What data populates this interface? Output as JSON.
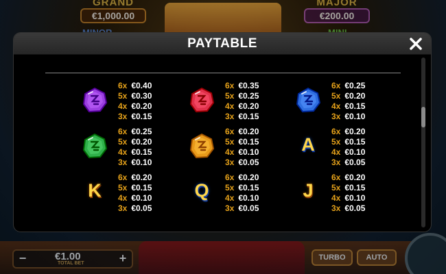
{
  "background": {
    "grand": {
      "label": "GRAND",
      "value": "€1,000.00"
    },
    "major": {
      "label": "MAJOR",
      "value": "€200.00"
    },
    "minor_label": "MINOR",
    "mini_label": "MINI",
    "bet_value": "€1.00",
    "bet_label": "TOTAL BET",
    "minus": "−",
    "plus": "+",
    "turbo_label": "TURBO",
    "auto_label": "AUTO"
  },
  "modal": {
    "title": "PAYTABLE",
    "close_icon": "close-icon",
    "symbols": [
      {
        "name": "purple-gem",
        "icon": "purple-gem-icon",
        "color": "#9b3fe0",
        "pays": [
          {
            "count": "6x",
            "amount": "€0.40"
          },
          {
            "count": "5x",
            "amount": "€0.30"
          },
          {
            "count": "4x",
            "amount": "€0.20"
          },
          {
            "count": "3x",
            "amount": "€0.15"
          }
        ]
      },
      {
        "name": "red-gem",
        "icon": "red-gem-icon",
        "color": "#e0304a",
        "pays": [
          {
            "count": "6x",
            "amount": "€0.35"
          },
          {
            "count": "5x",
            "amount": "€0.25"
          },
          {
            "count": "4x",
            "amount": "€0.20"
          },
          {
            "count": "3x",
            "amount": "€0.15"
          }
        ]
      },
      {
        "name": "blue-gem",
        "icon": "blue-gem-icon",
        "color": "#2f6ee0",
        "pays": [
          {
            "count": "6x",
            "amount": "€0.25"
          },
          {
            "count": "5x",
            "amount": "€0.20"
          },
          {
            "count": "4x",
            "amount": "€0.15"
          },
          {
            "count": "3x",
            "amount": "€0.10"
          }
        ]
      },
      {
        "name": "green-gem",
        "icon": "green-gem-icon",
        "color": "#2fb04a",
        "pays": [
          {
            "count": "6x",
            "amount": "€0.25"
          },
          {
            "count": "5x",
            "amount": "€0.20"
          },
          {
            "count": "4x",
            "amount": "€0.15"
          },
          {
            "count": "3x",
            "amount": "€0.10"
          }
        ]
      },
      {
        "name": "orange-gem",
        "icon": "orange-gem-icon",
        "color": "#e89a1a",
        "pays": [
          {
            "count": "6x",
            "amount": "€0.20"
          },
          {
            "count": "5x",
            "amount": "€0.15"
          },
          {
            "count": "4x",
            "amount": "€0.10"
          },
          {
            "count": "3x",
            "amount": "€0.05"
          }
        ]
      },
      {
        "name": "letter-a",
        "letter": "A",
        "pays": [
          {
            "count": "6x",
            "amount": "€0.20"
          },
          {
            "count": "5x",
            "amount": "€0.15"
          },
          {
            "count": "4x",
            "amount": "€0.10"
          },
          {
            "count": "3x",
            "amount": "€0.05"
          }
        ]
      },
      {
        "name": "letter-k",
        "letter": "K",
        "pays": [
          {
            "count": "6x",
            "amount": "€0.20"
          },
          {
            "count": "5x",
            "amount": "€0.15"
          },
          {
            "count": "4x",
            "amount": "€0.10"
          },
          {
            "count": "3x",
            "amount": "€0.05"
          }
        ]
      },
      {
        "name": "letter-q",
        "letter": "Q",
        "pays": [
          {
            "count": "6x",
            "amount": "€0.20"
          },
          {
            "count": "5x",
            "amount": "€0.15"
          },
          {
            "count": "4x",
            "amount": "€0.10"
          },
          {
            "count": "3x",
            "amount": "€0.05"
          }
        ]
      },
      {
        "name": "letter-j",
        "letter": "J",
        "pays": [
          {
            "count": "6x",
            "amount": "€0.20"
          },
          {
            "count": "5x",
            "amount": "€0.15"
          },
          {
            "count": "4x",
            "amount": "€0.10"
          },
          {
            "count": "3x",
            "amount": "€0.05"
          }
        ]
      }
    ]
  },
  "colors": {
    "multiplier": "#e6a21a",
    "amount": "#ffffff",
    "modal_bg": "#000000",
    "header_bg": "#2e2e2e"
  }
}
